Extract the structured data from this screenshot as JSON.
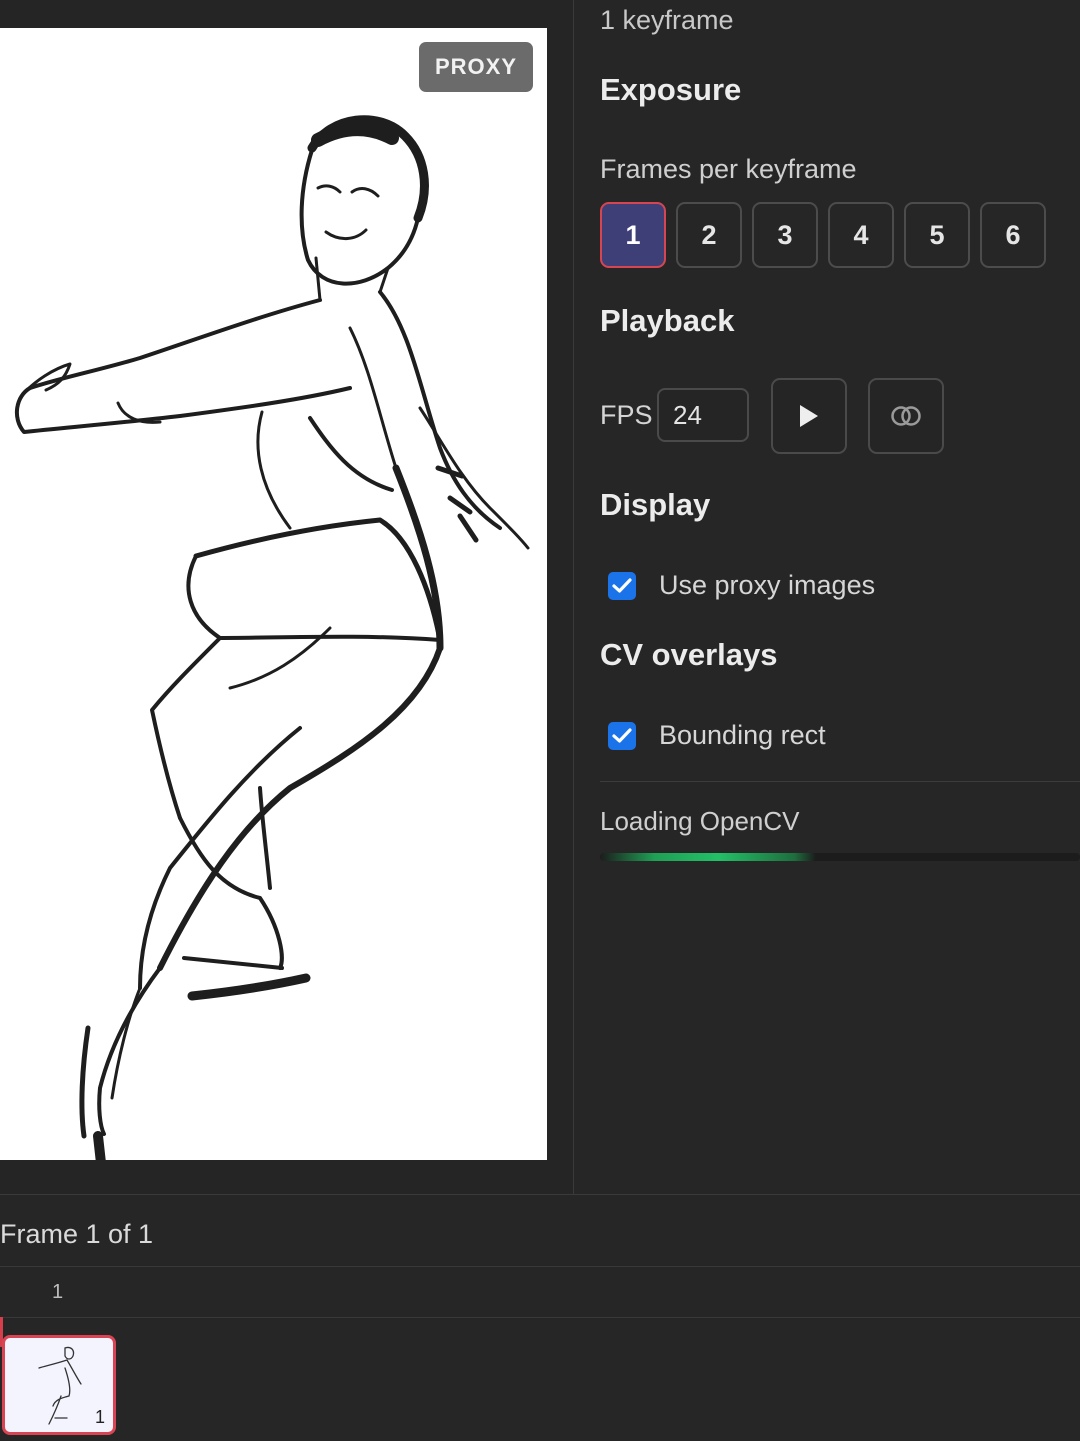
{
  "canvas": {
    "proxy_badge": "PROXY"
  },
  "panel": {
    "keyframe_count": "1 keyframe",
    "exposure": {
      "title": "Exposure",
      "label": "Frames per keyframe",
      "options": [
        "1",
        "2",
        "3",
        "4",
        "5",
        "6"
      ],
      "selected": "1"
    },
    "playback": {
      "title": "Playback",
      "fps_label": "FPS",
      "fps_value": "24",
      "play_icon": "play-icon",
      "onion_icon": "onion-skin-icon"
    },
    "display": {
      "title": "Display",
      "use_proxy_label": "Use proxy images",
      "use_proxy_checked": true
    },
    "cv_overlays": {
      "title": "CV overlays",
      "bounding_rect_label": "Bounding rect",
      "bounding_rect_checked": true
    },
    "loading": {
      "label": "Loading OpenCV",
      "progress": 0.45
    }
  },
  "timeline": {
    "frame_info": "Frame 1 of 1",
    "ruler": [
      "1"
    ],
    "thumbnails": [
      {
        "number": "1",
        "selected": true
      }
    ]
  },
  "colors": {
    "accent": "#d64552",
    "selected_bg": "#3f3f78",
    "checkbox": "#1a73e8",
    "progress": "#23c067"
  }
}
